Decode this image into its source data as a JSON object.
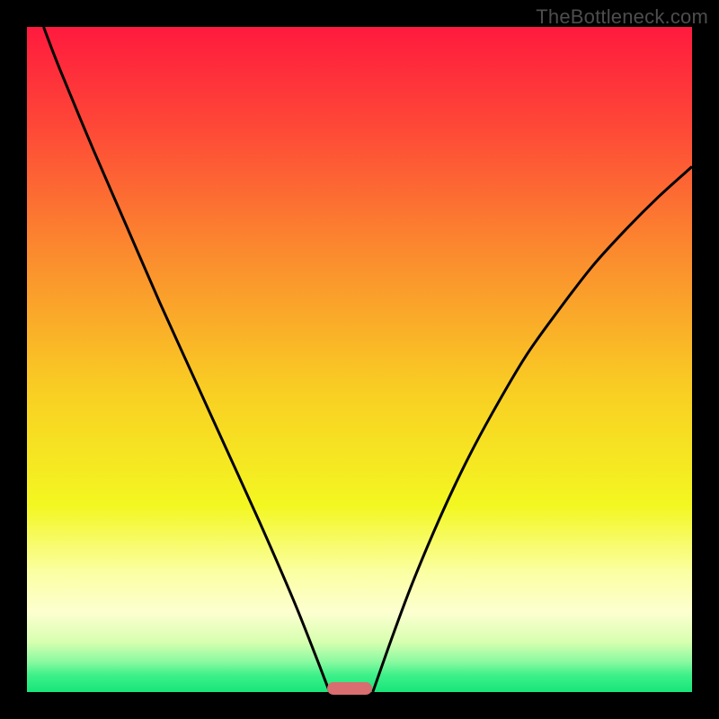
{
  "watermark": "TheBottleneck.com",
  "chart_data": {
    "type": "line",
    "title": "",
    "xlabel": "",
    "ylabel": "",
    "xlim": [
      0,
      1
    ],
    "ylim": [
      0,
      1
    ],
    "background_gradient": {
      "stops": [
        {
          "offset": 0.0,
          "color": "#ff1a3e"
        },
        {
          "offset": 0.15,
          "color": "#fe4837"
        },
        {
          "offset": 0.35,
          "color": "#fb8e2e"
        },
        {
          "offset": 0.55,
          "color": "#f9cf23"
        },
        {
          "offset": 0.72,
          "color": "#f3f721"
        },
        {
          "offset": 0.82,
          "color": "#fbffa2"
        },
        {
          "offset": 0.88,
          "color": "#fdffd0"
        },
        {
          "offset": 0.925,
          "color": "#d7ffb0"
        },
        {
          "offset": 0.955,
          "color": "#88f9a0"
        },
        {
          "offset": 0.975,
          "color": "#3df089"
        },
        {
          "offset": 1.0,
          "color": "#17e57a"
        }
      ]
    },
    "series": [
      {
        "name": "left-curve",
        "x": [
          0.025,
          0.05,
          0.1,
          0.15,
          0.2,
          0.25,
          0.3,
          0.35,
          0.4,
          0.43,
          0.455
        ],
        "y": [
          1.0,
          0.935,
          0.815,
          0.7,
          0.585,
          0.475,
          0.365,
          0.255,
          0.14,
          0.065,
          0.0
        ]
      },
      {
        "name": "right-curve",
        "x": [
          0.52,
          0.55,
          0.58,
          0.62,
          0.66,
          0.7,
          0.75,
          0.8,
          0.85,
          0.9,
          0.95,
          1.0
        ],
        "y": [
          0.0,
          0.085,
          0.165,
          0.26,
          0.345,
          0.42,
          0.505,
          0.575,
          0.64,
          0.695,
          0.745,
          0.79
        ]
      }
    ],
    "marker": {
      "name": "bottleneck-marker",
      "x_center": 0.485,
      "width": 0.068,
      "color": "#d96d6f"
    }
  }
}
